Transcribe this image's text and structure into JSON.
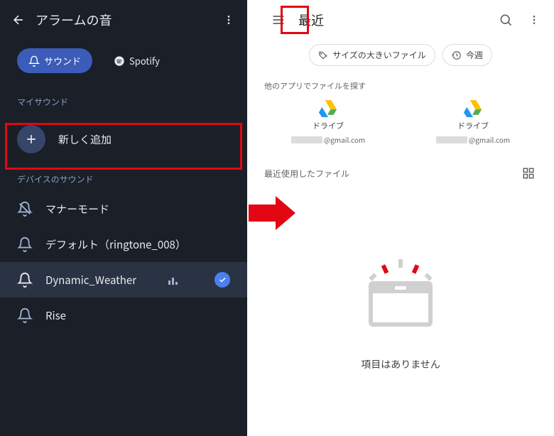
{
  "left": {
    "title": "アラームの音",
    "chips": {
      "sound": "サウンド",
      "spotify": "Spotify"
    },
    "section_my": "マイサウンド",
    "add_new": "新しく追加",
    "section_device": "デバイスのサウンド",
    "items": {
      "silent": "マナーモード",
      "default": "デフォルト（ringtone_008）",
      "dynamic": "Dynamic_Weather",
      "rise": "Rise"
    }
  },
  "right": {
    "title": "最近",
    "chip_large": "サイズの大きいファイル",
    "chip_week": "今週",
    "find_label": "他のアプリでファイルを探す",
    "drive_name": "ドライブ",
    "drive_domain": "@gmail.com",
    "recent_label": "最近使用したファイル",
    "empty": "項目はありません"
  }
}
